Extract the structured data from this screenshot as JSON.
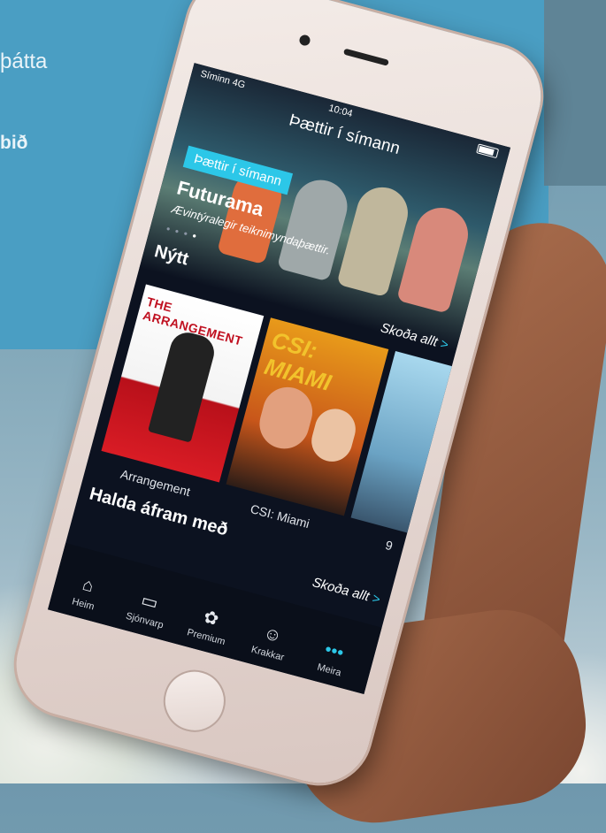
{
  "background": {
    "promo_line1": "þátta",
    "promo_line2": "bið",
    "accent": "#2cc7e8"
  },
  "status": {
    "carrier": "Síminn  4G",
    "time": "10:04"
  },
  "screen": {
    "title": "Þættir í símann",
    "hero": {
      "tag": "Þættir í símann",
      "name": "Futurama",
      "description": "Ævintýralegir teiknimyndaþættir."
    },
    "sections": [
      {
        "title": "Nýtt",
        "see_all": "Skoða allt",
        "see_all_chevron": ">"
      },
      {
        "title": "Halda áfram með",
        "see_all": "Skoða allt",
        "see_all_chevron": ">"
      }
    ],
    "posters": [
      {
        "title": "THE ARRANGEMENT",
        "label": "Arrangement"
      },
      {
        "title": "CSI: MIAMI",
        "label": "CSI: Miami"
      },
      {
        "title": "",
        "label": "9"
      }
    ],
    "tabs": [
      {
        "label": "Heim",
        "icon": "home-icon",
        "glyph": "⌂"
      },
      {
        "label": "Sjónvarp",
        "icon": "tv-icon",
        "glyph": "▭"
      },
      {
        "label": "Premium",
        "icon": "premium-icon",
        "glyph": "✿"
      },
      {
        "label": "Krakkar",
        "icon": "kids-smiley-icon",
        "glyph": "☺"
      },
      {
        "label": "Meira",
        "icon": "more-dots-icon",
        "glyph": "•••"
      }
    ]
  }
}
